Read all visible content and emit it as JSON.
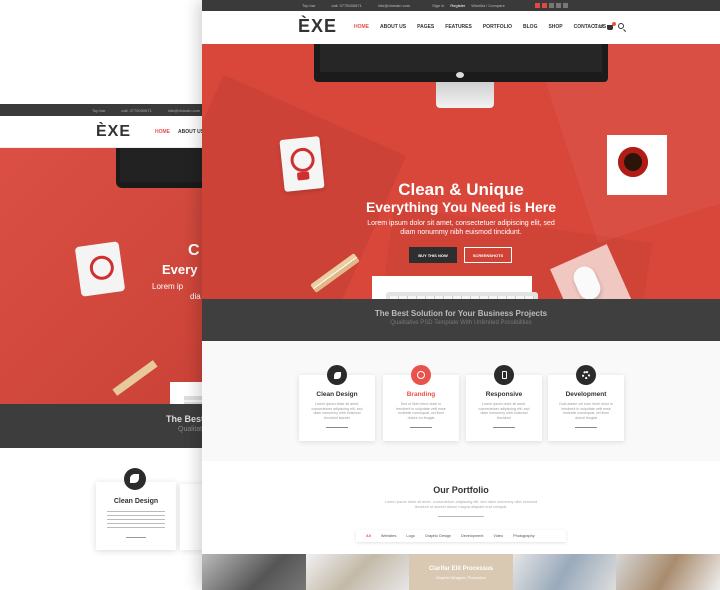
{
  "back": {
    "topbar": [
      "Top bar",
      "call: 0775000671",
      "info@domain.com"
    ],
    "logo": "ÈXE",
    "nav": {
      "home": "HOME",
      "about": "ABOUT US"
    },
    "hero": {
      "title1": "C",
      "title2": "Every",
      "sub1": "Lorem ip",
      "sub2": "dia"
    },
    "dark": {
      "title": "The Best",
      "subtitle": "Qualitat"
    },
    "card": {
      "title": "Clean Design",
      "text": "Lorem ipsum dolor sit amet consectetuer adipiscing elit sed diam nonummy nibh euismod tincidunt"
    }
  },
  "topbar": {
    "left": [
      "Top bar",
      "call: 0775000671",
      "info@domain.com"
    ],
    "signin": "Sign in",
    "register": "Register",
    "wishlist": "Wishlist / Compare"
  },
  "nav": {
    "logo": "ÈXE",
    "items": [
      "HOME",
      "ABOUT US",
      "PAGES",
      "FEATURES",
      "PORTFOLIO",
      "BLOG",
      "SHOP",
      "CONTACT US"
    ],
    "cart": "Cart"
  },
  "hero": {
    "title1": "Clean & Unique",
    "title2": "Everything You Need is Here",
    "desc1": "Lorem ipsum dolor sit amet, consectetuer adipiscing elit, sed",
    "desc2": "diam nonummy nibh euismod tincidunt.",
    "buy_button": "BUY THIS NOW",
    "screenshots_button": "SCREENSHOTS"
  },
  "banner": {
    "title": "The Best Solution for Your Business Projects",
    "subtitle": "Qualitative PSD Template With Unlimited Possibilities"
  },
  "features": [
    {
      "title": "Clean Design",
      "text": "Lorem ipsum dolor sit amet, consectetuer adipiscing elit, sed diam nonummy nibh euismod tincidunt laoreet",
      "icon": "leaf-icon"
    },
    {
      "title": "Branding",
      "text": "Sed ut illum iriure dolor in hendrerit in vulputate velit esse molestie consequat, vel illum dolore eu feugiat",
      "icon": "dribbble-icon"
    },
    {
      "title": "Responsive",
      "text": "Lorem ipsum dolor sit amet, consectetuer adipiscing elit, sed diam nonummy nibh euismod tincidunt",
      "icon": "mobile-icon"
    },
    {
      "title": "Development",
      "text": "Duis autem vel eum iriure dolor in hendrerit in vulputate velit esse molestie consequat, vel illum dolore feugiat",
      "icon": "gear-icon"
    }
  ],
  "portfolio": {
    "title": "Our Portfolio",
    "desc1": "Lorem ipsum dolor sit amet, consectetuer adipiscing elit, sed diam nonummy nibh euismod",
    "desc2": "tincidunt ut laoreet dolore magna aliquam erat volutpat.",
    "filters": [
      "All",
      "Websites",
      "Logo",
      "Graphic Design",
      "Development",
      "Video",
      "Photography"
    ],
    "featured_caption": "Clarifar Elit Processus",
    "featured_sub": "Graphic Designer, Production"
  },
  "colors": {
    "accent": "#e9524a",
    "hero": "#d9463a",
    "dark": "#3f3f3f"
  }
}
